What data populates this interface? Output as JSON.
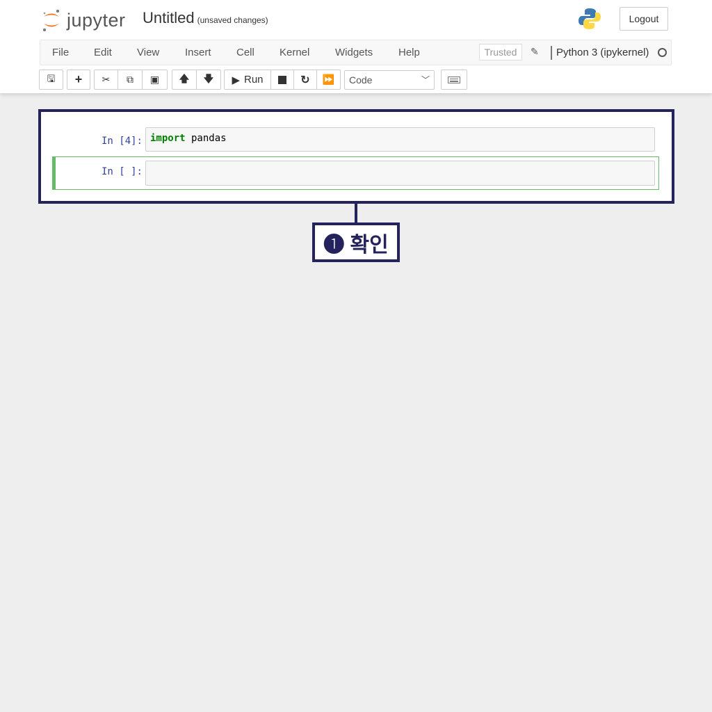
{
  "header": {
    "logo_text": "jupyter",
    "title": "Untitled",
    "status": "(unsaved changes)",
    "logout": "Logout"
  },
  "menu": [
    "File",
    "Edit",
    "View",
    "Insert",
    "Cell",
    "Kernel",
    "Widgets",
    "Help"
  ],
  "trusted": "Trusted",
  "kernel": "Python 3 (ipykernel)",
  "toolbar": {
    "run": "Run",
    "cell_type": "Code",
    "icons": [
      "save-icon",
      "plus-icon",
      "cut-icon",
      "copy-icon",
      "paste-icon",
      "arrow-up-icon",
      "arrow-down-icon",
      "play-icon",
      "stop-icon",
      "restart-icon",
      "fast-forward-icon",
      "keyboard-icon"
    ]
  },
  "cells": [
    {
      "prompt": "In [4]:",
      "keyword": "import",
      "code": " pandas"
    },
    {
      "prompt": "In [ ]:",
      "code": ""
    }
  ],
  "callout": {
    "text": "❶ 확인"
  },
  "colors": {
    "highlight": "#25235e",
    "selected_cell": "#66bb6a",
    "keyword": "#008000",
    "prompt": "#303f9f"
  }
}
